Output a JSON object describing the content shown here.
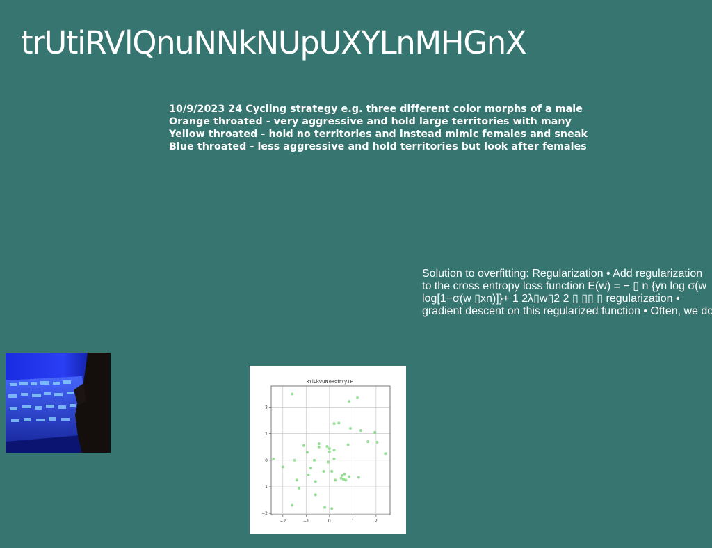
{
  "slide": {
    "title": "trUtiRVlQnuNNkNUpUXYLnMHGnX",
    "bio_lines": [
      "10/9/2023 24 Cycling strategy e.g. three different color morphs of a male",
      "Orange throated - very aggressive and hold large territories with many",
      "Yellow throated - hold no territories and instead mimic females and sneak",
      "Blue throated - less aggressive and hold territories but look after females"
    ],
    "ml_lines": [
      "Solution to overfitting: Regularization • Add regularization",
      "to the cross entropy loss function E(w) = − ▯ n {yn log σ(w",
      "log[1−σ(w ▯xn)]}+ 1 2λ▯w▯2 2 ▯ ▯▯ ▯ regularization •",
      "gradient descent on this regularized function • Often, we do"
    ],
    "photo_icon": "blue-lit-glass-display-photo"
  },
  "chart_data": {
    "type": "scatter",
    "title": "xYlLkvuNexdfrYyTF",
    "xlabel": "",
    "ylabel": "",
    "xlim": [
      -2.5,
      2.6
    ],
    "ylim": [
      -2.05,
      2.8
    ],
    "xticks": [
      -2,
      -1,
      0,
      1,
      2
    ],
    "yticks": [
      -2,
      -1,
      0,
      1,
      2
    ],
    "grid": true,
    "point_color": "#90dd90",
    "points": [
      [
        -2.4,
        0.05
      ],
      [
        -2.0,
        -0.25
      ],
      [
        -1.6,
        2.5
      ],
      [
        -1.6,
        -1.7
      ],
      [
        -1.5,
        0.0
      ],
      [
        -1.4,
        -0.75
      ],
      [
        -1.3,
        -1.05
      ],
      [
        -1.1,
        0.55
      ],
      [
        -0.95,
        0.3
      ],
      [
        -0.9,
        -0.55
      ],
      [
        -0.8,
        -0.3
      ],
      [
        -0.65,
        0.0
      ],
      [
        -0.6,
        -0.8
      ],
      [
        -0.6,
        -1.3
      ],
      [
        -0.45,
        0.5
      ],
      [
        -0.45,
        0.62
      ],
      [
        -0.25,
        -0.42
      ],
      [
        -0.2,
        -1.78
      ],
      [
        -0.1,
        0.52
      ],
      [
        -0.05,
        -0.07
      ],
      [
        0.0,
        0.32
      ],
      [
        0.0,
        0.44
      ],
      [
        0.1,
        -0.42
      ],
      [
        0.1,
        -1.82
      ],
      [
        0.2,
        0.38
      ],
      [
        0.2,
        0.05
      ],
      [
        0.2,
        1.38
      ],
      [
        0.25,
        -0.75
      ],
      [
        0.4,
        1.4
      ],
      [
        0.5,
        -0.68
      ],
      [
        0.55,
        -0.58
      ],
      [
        0.6,
        -0.72
      ],
      [
        0.65,
        -0.52
      ],
      [
        0.7,
        -0.75
      ],
      [
        0.8,
        0.58
      ],
      [
        0.85,
        -0.62
      ],
      [
        0.85,
        2.22
      ],
      [
        0.9,
        1.2
      ],
      [
        1.2,
        2.35
      ],
      [
        1.25,
        -0.65
      ],
      [
        1.35,
        1.12
      ],
      [
        1.65,
        0.7
      ],
      [
        1.95,
        1.05
      ],
      [
        2.05,
        0.68
      ],
      [
        2.4,
        0.25
      ]
    ]
  }
}
